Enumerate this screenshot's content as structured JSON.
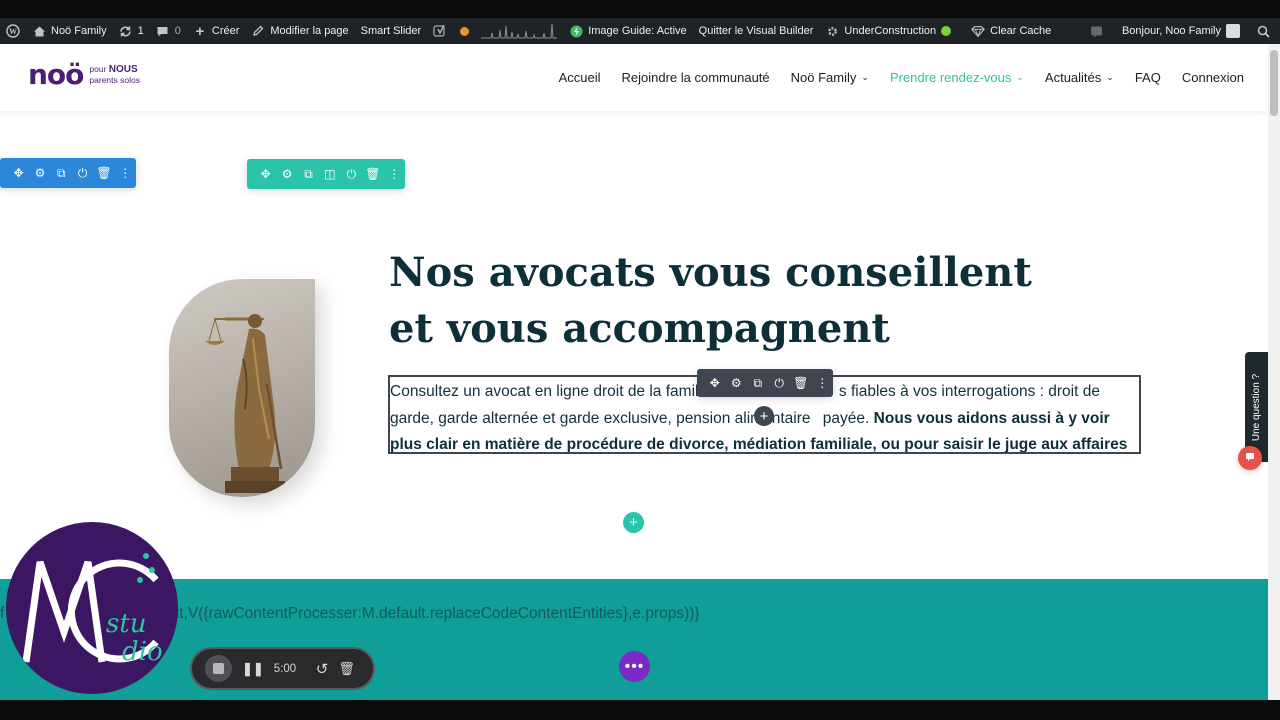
{
  "admin_bar": {
    "site_name": "Noö Family",
    "updates_count": "1",
    "comments_count": "0",
    "create_label": "Créer",
    "edit_page_label": "Modifier la page",
    "smart_slider_label": "Smart Slider",
    "image_guide_label": "Image Guide: Active",
    "quit_builder_label": "Quitter le Visual Builder",
    "under_construction_label": "UnderConstruction",
    "clear_cache_label": "Clear Cache",
    "greeting": "Bonjour, Noo Family",
    "status_orange": "#f0922b",
    "status_green": "#7ad03a"
  },
  "header": {
    "logo_word": "noö",
    "logo_tag_pour": "pour",
    "logo_tag_nous": "NOUS",
    "logo_tag_line": "parents solos",
    "nav": [
      {
        "label": "Accueil",
        "has_dropdown": false
      },
      {
        "label": "Rejoindre la communauté",
        "has_dropdown": false
      },
      {
        "label": "Noö Family",
        "has_dropdown": true
      },
      {
        "label": "Prendre rendez-vous",
        "has_dropdown": true,
        "active": true
      },
      {
        "label": "Actualités",
        "has_dropdown": true
      },
      {
        "label": "FAQ",
        "has_dropdown": false
      },
      {
        "label": "Connexion",
        "has_dropdown": false
      }
    ]
  },
  "content": {
    "heading_line1": "Nos avocats vous conseillent",
    "heading_line2": "et vous accompagnent",
    "para_start": "Consultez un avocat en ligne droit de la famill",
    "para_mid": "s fiables à vos interrogations : droit de garde, garde alternée et garde exclusive, pension alimentaire ",
    "para_mid2": "payée. ",
    "para_bold": "Nous vous aidons aussi à y voir plus clair en matière de procédure de divorce, médiation familiale, ou pour saisir le juge aux affaires familiales.",
    "code_text": "f                    t.createElement(E.default,V({rawContentProcesser:M.default.replaceCodeContentEntities},e.props))}"
  },
  "widgets": {
    "question_tab": "Une question ?",
    "recorder_time": "5:00"
  },
  "colors": {
    "admin_bg": "#1d2327",
    "brand_purple": "#4b1d73",
    "accent_teal": "#2ec4a0",
    "heading_navy": "#0d2f3a",
    "section_teal": "#109e98",
    "toolbar_blue": "#2b87da",
    "toolbar_green": "#29c4a9",
    "toolbar_dark": "#3f4652",
    "fab_purple": "#7b2ac7"
  }
}
